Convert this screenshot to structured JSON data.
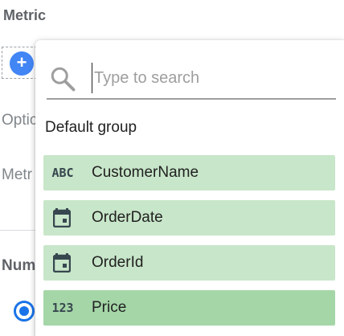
{
  "panel": {
    "heading": "Metric",
    "add_symbol": "+",
    "options_label": "Optic",
    "metric_label": "Metr",
    "number_label": "Num"
  },
  "search": {
    "placeholder": "Type to search",
    "value": ""
  },
  "group": {
    "label": "Default group"
  },
  "fields": [
    {
      "label": "CustomerName",
      "type": "text",
      "type_text": "ABC",
      "icon": "text-type-icon",
      "active": false
    },
    {
      "label": "OrderDate",
      "type": "date",
      "icon": "calendar-icon",
      "active": false
    },
    {
      "label": "OrderId",
      "type": "date",
      "icon": "calendar-icon",
      "active": false
    },
    {
      "label": "Price",
      "type": "number",
      "type_text": "123",
      "icon": "number-type-icon",
      "active": true
    }
  ],
  "colors": {
    "field_bg": "#c8e6c9",
    "field_active_bg": "#a5d6a7",
    "accent": "#1a73e8",
    "add_button": "#4285f4"
  }
}
